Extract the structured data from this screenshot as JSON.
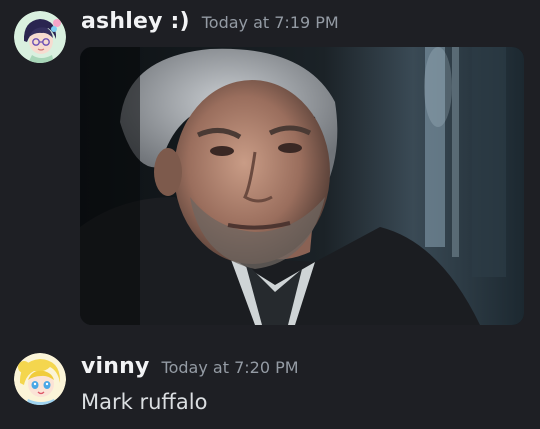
{
  "messages": [
    {
      "author": "ashley :)",
      "timestamp": "Today at 7:19 PM",
      "avatar_icon": "anime-avatar-icon",
      "attachment": {
        "type": "image",
        "subject": "gray-haired man in dark coat"
      }
    },
    {
      "author": "vinny",
      "timestamp": "Today at 7:20 PM",
      "avatar_icon": "anime-avatar-icon",
      "text": "Mark ruffalo"
    }
  ],
  "colors": {
    "background": "#1e1f24",
    "username": "#f2f3f5",
    "timestamp": "#949ba4",
    "message_text": "#dbdee1"
  }
}
